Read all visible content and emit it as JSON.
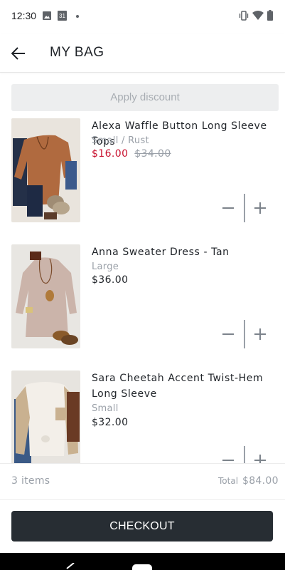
{
  "status_bar": {
    "time": "12:30",
    "calendar_day": "31"
  },
  "header": {
    "title": "MY BAG"
  },
  "discount": {
    "label": "Apply discount"
  },
  "items": [
    {
      "name": "Alexa Waffle Button Long Sleeve Tops",
      "variant": "Small / Rust",
      "price": "$16.00",
      "original_price": "$34.00"
    },
    {
      "name": "Anna Sweater Dress - Tan",
      "variant": "Large",
      "price": "$36.00"
    },
    {
      "name": "Sara Cheetah Accent Twist-Hem Long Sleeve",
      "variant": "Small",
      "price": "$32.00"
    }
  ],
  "summary": {
    "count": "3 items",
    "total_label": "Total",
    "total_value": "$84.00"
  },
  "checkout": {
    "label": "CHECKOUT"
  },
  "colors": {
    "sale": "#c8102e",
    "muted": "#9aa0a8",
    "button": "#272d33"
  }
}
